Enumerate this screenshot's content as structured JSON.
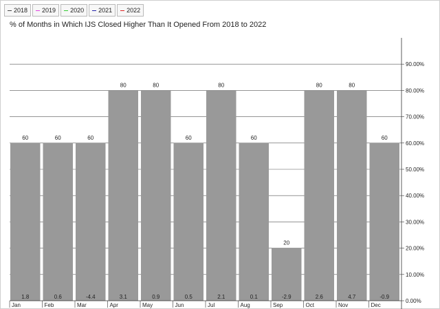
{
  "legend": [
    {
      "label": "2018",
      "color": "#444444"
    },
    {
      "label": "2019",
      "color": "#e040e0"
    },
    {
      "label": "2020",
      "color": "#33cc33"
    },
    {
      "label": "2021",
      "color": "#2222aa"
    },
    {
      "label": "2022",
      "color": "#dd2222"
    }
  ],
  "colors": {
    "bar": "#999999",
    "gridline": "#555555",
    "axis": "#333333"
  },
  "chart_data": {
    "type": "bar",
    "title": "% of Months in Which IJS Closed Higher Than It Opened From 2018 to 2022",
    "categories": [
      "Jan",
      "Feb",
      "Mar",
      "Apr",
      "May",
      "Jun",
      "Jul",
      "Aug",
      "Sep",
      "Oct",
      "Nov",
      "Dec"
    ],
    "values": [
      60,
      60,
      60,
      80,
      80,
      60,
      80,
      60,
      20,
      80,
      80,
      60
    ],
    "bottom_labels": [
      "1.8",
      "0.6",
      "-4.4",
      "3.1",
      "0.9",
      "0.5",
      "2.1",
      "0.1",
      "-2.9",
      "2.6",
      "4.7",
      "-0.9"
    ],
    "y_ticks": [
      "0.00%",
      "10.00%",
      "20.00%",
      "30.00%",
      "40.00%",
      "50.00%",
      "60.00%",
      "70.00%",
      "80.00%",
      "90.00%"
    ],
    "ylim": [
      0,
      100
    ],
    "grid": true,
    "legend_position": "top-left"
  }
}
